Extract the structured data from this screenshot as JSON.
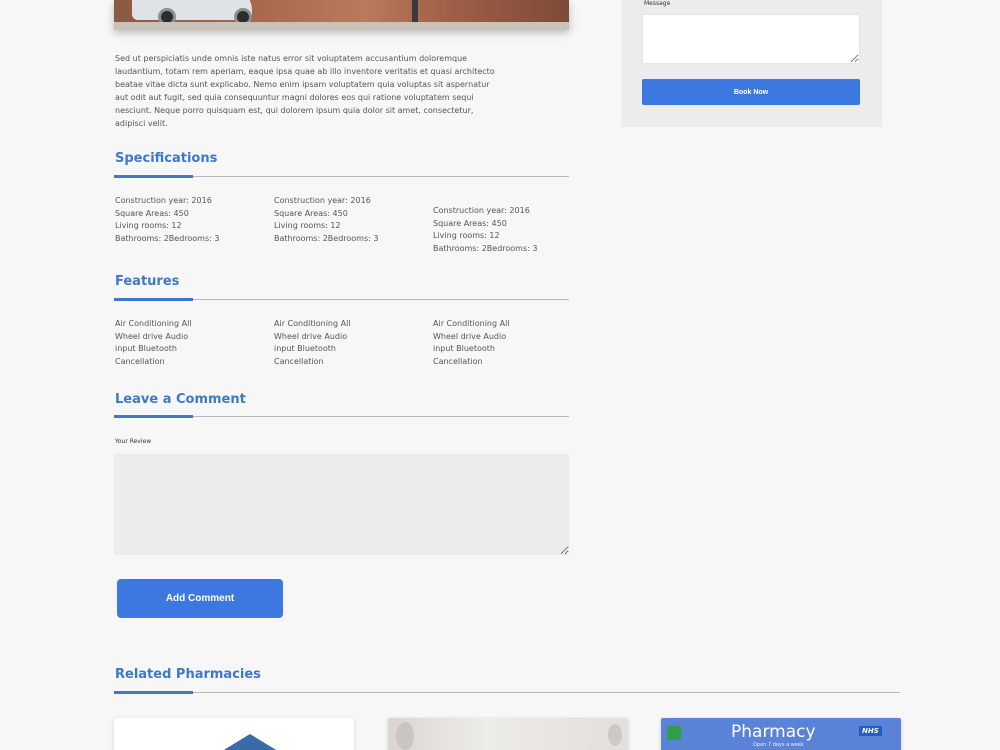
{
  "description": "Sed ut perspiciatis unde omnis iste natus error sit voluptatem accusantium doloremque laudantium, totam rem aperiam, eaque ipsa quae ab illo inventore veritatis et quasi architecto beatae vitae dicta sunt explicabo. Nemo enim ipsam voluptatem quia voluptas sit aspernatur aut odit aut fugit, sed quia consequuntur magni dolores eos qui ratione voluptatem sequi nesciunt. Neque porro quisquam est, qui dolorem ipsum quia dolor sit amet, consectetur, adipisci velit.",
  "specifications": {
    "title": "Specifications",
    "columns": [
      [
        "Construction year: 2016",
        "Square Areas: 450",
        "Living rooms: 12",
        "Bathrooms: 2Bedrooms: 3"
      ],
      [
        "Construction year: 2016",
        "Square Areas: 450",
        "Living rooms: 12",
        "Bathrooms: 2Bedrooms: 3"
      ],
      [
        "Construction year: 2016",
        "Square Areas: 450",
        "Living rooms: 12",
        "Bathrooms: 2Bedrooms: 3"
      ]
    ]
  },
  "features": {
    "title": "Features",
    "columns": [
      [
        "Air Conditioning All",
        "Wheel drive Audio",
        "input Bluetooth",
        "Cancellation"
      ],
      [
        "Air Conditioning All",
        "Wheel drive Audio",
        "input Bluetooth",
        "Cancellation"
      ],
      [
        "Air Conditioning All",
        "Wheel drive Audio",
        "input Bluetooth",
        "Cancellation"
      ]
    ]
  },
  "comment": {
    "title": "Leave a Comment",
    "review_label": "Your Review",
    "review_value": "",
    "button": "Add Comment"
  },
  "related": {
    "title": "Related Pharmacies",
    "card3_sign": "Pharmacy",
    "card3_sub": "Open 7 days a week",
    "card3_badge": "NHS"
  },
  "sidebar": {
    "message_label": "Message",
    "message_value": "",
    "book_button": "Book Now"
  },
  "colors": {
    "accent": "#3d78c9",
    "button": "#3d78e0",
    "background": "#f7f7f7"
  }
}
